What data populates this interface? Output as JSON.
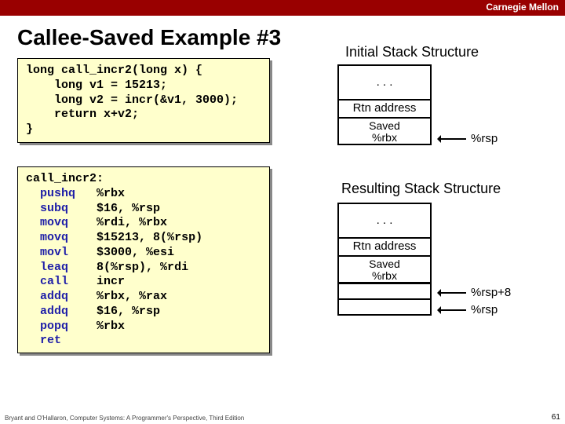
{
  "topbar": {
    "brand": "Carnegie Mellon"
  },
  "title": "Callee-Saved Example #3",
  "code_c": "long call_incr2(long x) {\n    long v1 = 15213;\n    long v2 = incr(&v1, 3000);\n    return x+v2;\n}",
  "asm": {
    "label": "call_incr2:",
    "lines": [
      {
        "op": "pushq",
        "arg": "%rbx"
      },
      {
        "op": "subq",
        "arg": "$16, %rsp"
      },
      {
        "op": "movq",
        "arg": "%rdi, %rbx"
      },
      {
        "op": "movq",
        "arg": "$15213, 8(%rsp)"
      },
      {
        "op": "movl",
        "arg": "$3000, %esi"
      },
      {
        "op": "leaq",
        "arg": "8(%rsp), %rdi"
      },
      {
        "op": "call",
        "arg": "incr"
      },
      {
        "op": "addq",
        "arg": "%rbx, %rax"
      },
      {
        "op": "addq",
        "arg": "$16, %rsp"
      },
      {
        "op": "popq",
        "arg": "%rbx"
      },
      {
        "op": "ret",
        "arg": ""
      }
    ]
  },
  "stack1": {
    "heading": "Initial Stack Structure",
    "dots": ". . .",
    "rtn": "Rtn address",
    "saved": "Saved\n%rbx",
    "ptr": "%rsp"
  },
  "stack2": {
    "heading": "Resulting Stack Structure",
    "dots": ". . .",
    "rtn": "Rtn address",
    "saved": "Saved\n%rbx",
    "ptr1": "%rsp+8",
    "ptr2": "%rsp"
  },
  "footer": "Bryant and O'Hallaron, Computer Systems: A Programmer's Perspective, Third Edition",
  "pagenum": "61"
}
